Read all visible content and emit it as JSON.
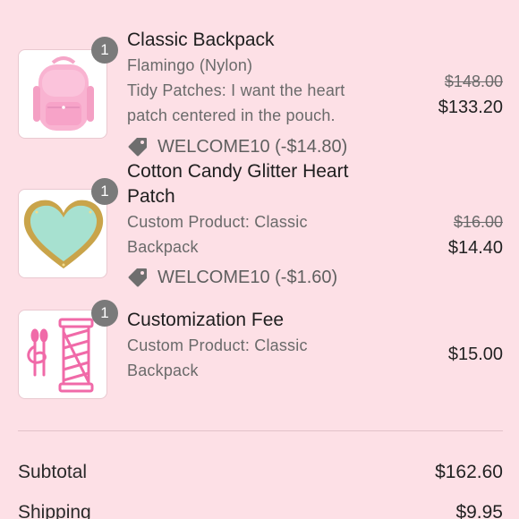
{
  "items": [
    {
      "qty": "1",
      "title_lines": [
        "Classic Backpack"
      ],
      "subtitle_lines": [
        "Flamingo (Nylon)",
        "Tidy Patches: I want the heart",
        "patch centered in the pouch."
      ],
      "discount": "WELCOME10 (-$14.80)",
      "original_price": "$148.00",
      "price": "$133.20",
      "image_icon": "pink-backpack-icon"
    },
    {
      "qty": "1",
      "title_lines": [
        "Cotton Candy Glitter Heart",
        "Patch"
      ],
      "subtitle_lines": [
        "Custom Product: Classic",
        "Backpack"
      ],
      "discount": "WELCOME10 (-$1.60)",
      "original_price": "$16.00",
      "price": "$14.40",
      "image_icon": "glitter-heart-patch-icon"
    },
    {
      "qty": "1",
      "title_lines": [
        "Customization Fee"
      ],
      "subtitle_lines": [
        "Custom Product: Classic",
        "Backpack"
      ],
      "price": "$15.00",
      "image_icon": "needle-thread-icon"
    }
  ],
  "summary": {
    "subtotal_label": "Subtotal",
    "subtotal_value": "$162.60",
    "shipping_label": "Shipping",
    "shipping_value": "$9.95"
  },
  "colors": {
    "background": "#fde0e6",
    "badge": "#7a7a7a",
    "tag_icon": "#6e6e6e",
    "accent_pink": "#f06aa8"
  }
}
